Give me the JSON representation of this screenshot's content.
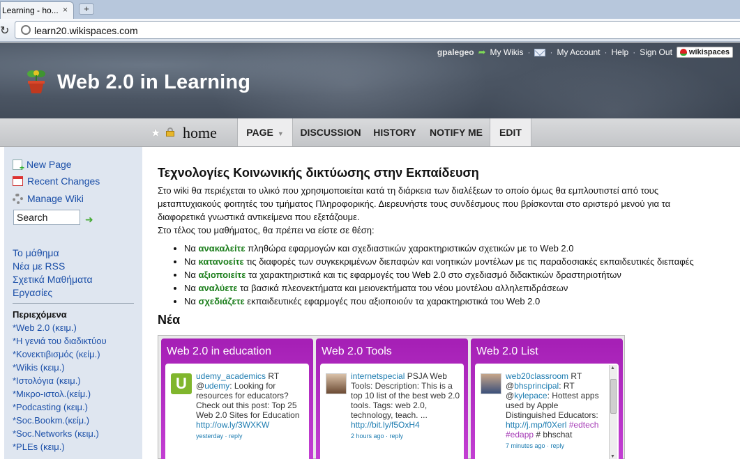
{
  "browser": {
    "tab_title": "Learning - ho...",
    "tab_close": "×",
    "new_tab": "+",
    "url": "learn20.wikispaces.com"
  },
  "header": {
    "username": "gpalegeo",
    "my_wikis": "My Wikis",
    "my_account": "My Account",
    "help": "Help",
    "sign_out": "Sign Out",
    "brand": "wikispaces",
    "sep": "·",
    "site_title": "Web 2.0 in Learning"
  },
  "tabs": {
    "page_name": "home",
    "page": "PAGE",
    "discussion": "DISCUSSION",
    "history": "HISTORY",
    "notify": "NOTIFY ME",
    "edit": "EDIT"
  },
  "sidebar": {
    "new_page": "New Page",
    "recent_changes": "Recent Changes",
    "manage_wiki": "Manage Wiki",
    "search_placeholder": "Search",
    "links": [
      "Το μάθημα",
      "Νέα με RSS",
      "Σχετικά Μαθήματα",
      "Εργασίες"
    ],
    "toc_heading": "Περιεχόμενα",
    "toc": [
      {
        "main": "*Web 2.0 ",
        "sub": "(κειμ.)"
      },
      {
        "main": "*Η γενιά του διαδικτύου",
        "sub": ""
      },
      {
        "main": "*Κονεκτιβισμός ",
        "sub": "(κείμ.)"
      },
      {
        "main": "*Wikis ",
        "sub": "(κειμ.)"
      },
      {
        "main": "*Ιστολόγια ",
        "sub": "(κειμ.)"
      },
      {
        "main": "*Μικρο-ιστολ.",
        "sub": "(κείμ.)"
      },
      {
        "main": "*Podcasting ",
        "sub": "(κειμ.)"
      },
      {
        "main": "*Soc.Bookm.",
        "sub": "(κείμ.)"
      },
      {
        "main": "*Soc.Networks ",
        "sub": "(κειμ.)"
      },
      {
        "main": "*PLEs ",
        "sub": "(κειμ.)"
      }
    ]
  },
  "main": {
    "title": "Τεχνολογίες Κοινωνικής δικτύωσης στην Εκπαίδευση",
    "intro": "Στο wiki θα περιέχεται το υλικό που χρησιμοποιείται κατά τη διάρκεια των διαλέξεων το οποίο όμως θα εμπλουτιστεί από τους μεταπτυχιακούς φοιτητές του τμήματος Πληροφορικής. Διερευνήστε τους συνδέσμους που βρίσκονται στο αριστερό μενού για τα διαφορετικά γνωστικά αντικείμενα που εξετάζουμε.",
    "goal": "Στο τέλος του μαθήματος, θα πρέπει να είστε σε θέση:",
    "bullets": [
      {
        "pre": "Να ",
        "kw": "ανακαλείτε",
        "post": " πληθώρα εφαρμογών και σχεδιαστικών χαρακτηριστικών σχετικών με το Web 2.0"
      },
      {
        "pre": "Να ",
        "kw": "κατανοείτε",
        "post": " τις διαφορές των συγκεκριμένων διεπαφών και νοητικών μοντέλων με τις παραδοσιακές εκπαιδευτικές διεπαφές"
      },
      {
        "pre": "Να ",
        "kw": "αξιοποιείτε",
        "post": " τα χαρακτηριστικά και τις εφαρμογές του Web 2.0 στο σχεδιασμό διδακτικών δραστηριοτήτων"
      },
      {
        "pre": "Να ",
        "kw": "αναλύετε",
        "post": " τα βασικά πλεονεκτήματα και μειονεκτήματα του νέου μοντέλου αλληλεπιδράσεων"
      },
      {
        "pre": "Να ",
        "kw": "σχεδιάζετε",
        "post": " εκπαιδευτικές εφαρμογές που αξιοποιούν τα χαρακτηριστικά του Web 2.0"
      }
    ],
    "news_heading": "Νέα"
  },
  "widgets": [
    {
      "title": "Web 2.0 in education",
      "user": "udemy_academics",
      "t1": " RT @",
      "mention": "udemy",
      "t2": ": Looking for resources for educators? Check out this post: Top 25 Web 2.0 Sites for Education ",
      "link": "http://ow.ly/3WXKW",
      "time": "yesterday",
      "reply": "reply",
      "avatar": "U"
    },
    {
      "title": "Web 2.0 Tools",
      "user": "internetspecial",
      "t1": " PSJA Web Tools: Description: This is a top 10 list of the best web 2.0 tools. Tags: web 2.0, technology, teach. ... ",
      "link": "http://bit.ly/f5OxH4",
      "time": "2 hours ago",
      "reply": "reply"
    },
    {
      "title": "Web 2.0 List",
      "user": "web20classroom",
      "t1": " RT @",
      "mention1": "bhsprincipal",
      "t2": ": RT @",
      "mention2": "kylepace",
      "t3": ": Hottest apps used by Apple Distinguished Educators: ",
      "link": "http://j.mp/f0Xerl",
      "tag1": "#edtech",
      "tag2": "#edapp",
      "t4": " # bhschat",
      "time": "7 minutes ago",
      "reply": "reply"
    }
  ],
  "colors": {
    "widget_purple": "#b52fc5",
    "link_blue": "#1b4fa8",
    "keyword_green": "#1a7d1a"
  }
}
